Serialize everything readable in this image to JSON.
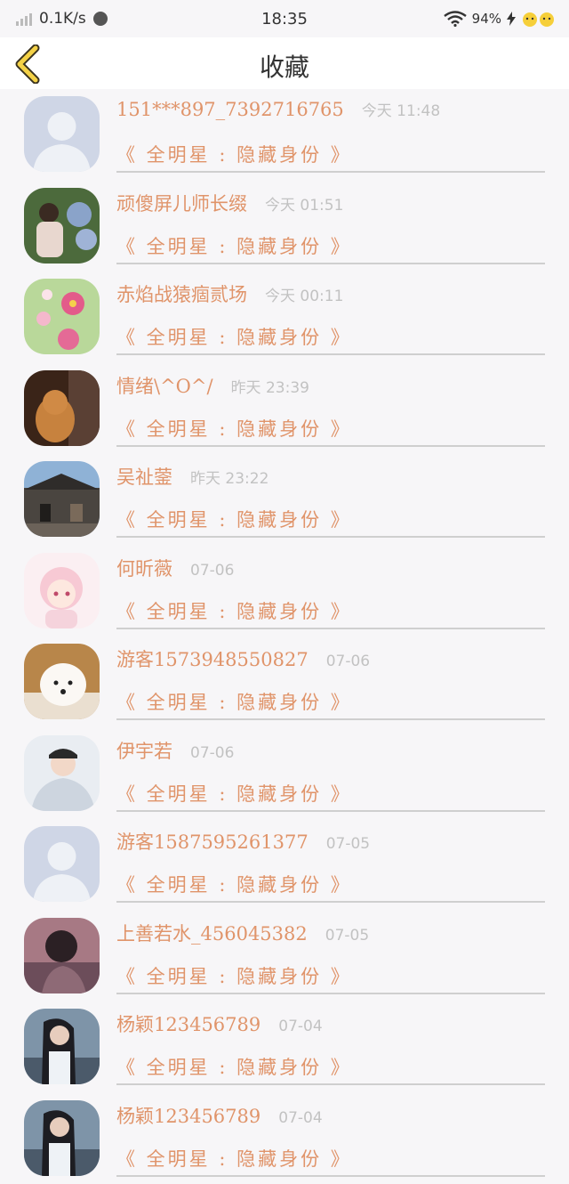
{
  "status_bar": {
    "net_speed": "0.1K/s",
    "time": "18:35",
    "battery": "94%"
  },
  "header": {
    "title": "收藏"
  },
  "items": [
    {
      "name": "151***897_7392716765",
      "time": "今天 11:48",
      "book": "《 全明星 : 隐藏身份 》",
      "avatar": "default-avatar"
    },
    {
      "name": "顽傻屏儿师长缀",
      "time": "今天 01:51",
      "book": "《 全明星 : 隐藏身份 》",
      "avatar": "girl-flowers"
    },
    {
      "name": "赤焰战猿痼贰场",
      "time": "今天 00:11",
      "book": "《 全明星 : 隐藏身份 》",
      "avatar": "pink-flowers"
    },
    {
      "name": "情绪\\^O^/",
      "time": "昨天 23:39",
      "book": "《 全明星 : 隐藏身份 》",
      "avatar": "dog-dark"
    },
    {
      "name": "吴祉蓥",
      "time": "昨天 23:22",
      "book": "《 全明星 : 隐藏身份 》",
      "avatar": "building"
    },
    {
      "name": "何昕薇",
      "time": "07-06",
      "book": "《 全明星 : 隐藏身份 》",
      "avatar": "anime-girl"
    },
    {
      "name": "游客1573948550827",
      "time": "07-06",
      "book": "《 全明星 : 隐藏身份 》",
      "avatar": "white-dog"
    },
    {
      "name": "伊宇若",
      "time": "07-06",
      "book": "《 全明星 : 隐藏身份 》",
      "avatar": "boy-hoodie"
    },
    {
      "name": "游客1587595261377",
      "time": "07-05",
      "book": "《 全明星 : 隐藏身份 》",
      "avatar": "default-avatar"
    },
    {
      "name": "上善若水_456045382",
      "time": "07-05",
      "book": "《 全明星 : 隐藏身份 》",
      "avatar": "woman-dusk"
    },
    {
      "name": "杨颖123456789",
      "time": "07-04",
      "book": "《 全明星 : 隐藏身份 》",
      "avatar": "woman-beach"
    },
    {
      "name": "杨颖123456789",
      "time": "07-04",
      "book": "《 全明星 : 隐藏身份 》",
      "avatar": "woman-beach"
    }
  ]
}
